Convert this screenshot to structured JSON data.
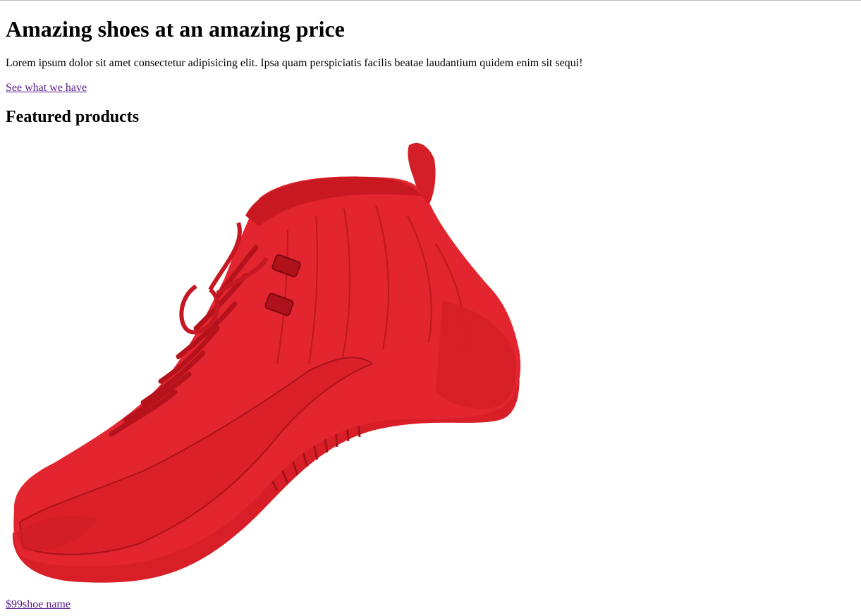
{
  "hero": {
    "title": "Amazing shoes at an amazing price",
    "description": "Lorem ipsum dolor sit amet consectetur adipisicing elit. Ipsa quam perspiciatis facilis beatae laudantium quidem enim sit sequi!",
    "cta_label": "See what we have"
  },
  "featured": {
    "heading": "Featured products",
    "products": [
      {
        "price": "$99",
        "name": "shoe name",
        "image": "red-high-top-sneaker"
      }
    ]
  },
  "colors": {
    "shoe_red": "#e2252f",
    "visited_link": "#551a8b"
  }
}
